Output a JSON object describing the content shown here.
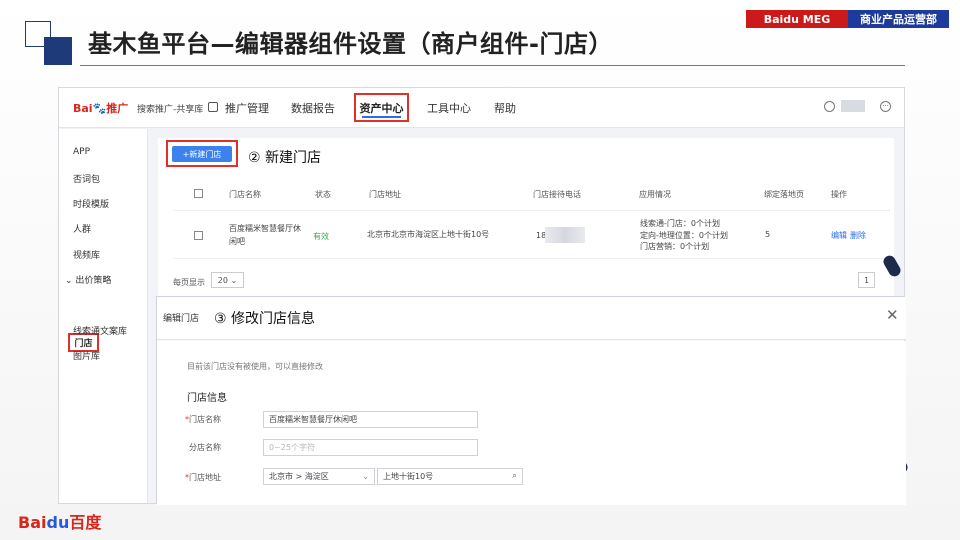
{
  "header": {
    "title": "基木鱼平台—编辑器组件设置（商户组件-门店）",
    "tag_red": "Baidu MEG",
    "tag_blue": "商业产品运营部"
  },
  "topbar": {
    "logo_text": "Bai",
    "logo_paw": "🐾",
    "logo_suffix": "推广",
    "share_label": "搜索推广-共享库",
    "nav": [
      "推广管理",
      "数据报告",
      "资产中心",
      "工具中心",
      "帮助"
    ]
  },
  "sidebar": {
    "items": [
      "APP",
      "否词包",
      "时段模版",
      "人群",
      "视频库",
      "⌄ 出价策略",
      "门店",
      "线索通文案库",
      "图片库"
    ]
  },
  "store_list": {
    "new_button": "+新建门店",
    "step_label": "② 新建门店",
    "columns": [
      "门店名称",
      "状态",
      "门店地址",
      "门店接待电话",
      "应用情况",
      "绑定落地页",
      "操作"
    ],
    "row": {
      "name_line1": "百度糯米智慧餐厅休",
      "name_line2": "闲吧",
      "status": "有效",
      "address": "北京市北京市海淀区上地十街10号",
      "phone": "18",
      "usage": [
        "线索通-门店：0个计划",
        "定向-地理位置：0个计划",
        "门店营销：0个计划"
      ],
      "landing_count": "5",
      "op_edit": "编辑",
      "op_delete": "删除"
    },
    "pager_label": "每页显示",
    "page_size": "20 ⌄",
    "page_num": "1"
  },
  "edit_modal": {
    "title": "编辑门店",
    "step_label": "③ 修改门店信息",
    "close": "✕",
    "notice": "目前该门店没有被使用，可以直接修改",
    "section_title": "门店信息",
    "fields": {
      "name_label": "门店名称",
      "name_value": "百度糯米智慧餐厅休闲吧",
      "branch_label": "分店名称",
      "branch_placeholder": "0~25个字符",
      "address_label": "门店地址",
      "address_region": "北京市 > 海淀区",
      "address_detail": "上地十街10号"
    }
  },
  "footer": {
    "logo_text": "Bai",
    "logo_paw": "du",
    "logo_suffix": "百度"
  },
  "colors": {
    "navy": "#1e3a78",
    "highlight_red": "#e0302a",
    "primary_blue": "#3b82ee",
    "tag_red": "#cc1a1a",
    "tag_blue": "#1e3a9a"
  }
}
